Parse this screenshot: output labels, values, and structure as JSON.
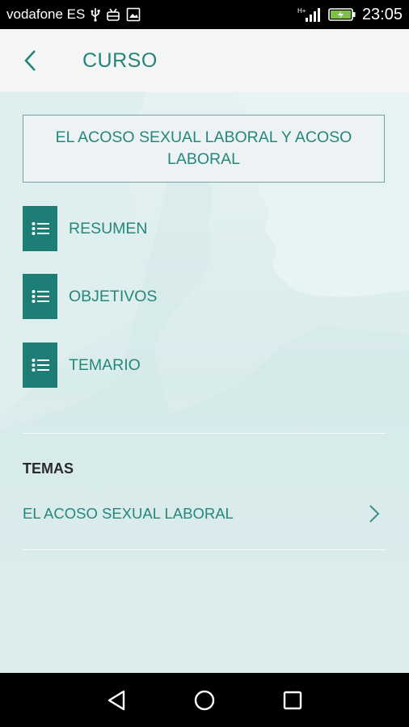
{
  "status_bar": {
    "carrier": "vodafone ES",
    "network": "H+",
    "time": "23:05"
  },
  "header": {
    "title": "CURSO"
  },
  "course": {
    "title": "EL ACOSO SEXUAL LABORAL Y ACOSO LABORAL"
  },
  "menu": [
    {
      "label": "RESUMEN",
      "icon": "list-icon"
    },
    {
      "label": "OBJETIVOS",
      "icon": "list-icon"
    },
    {
      "label": "TEMARIO",
      "icon": "list-icon"
    }
  ],
  "temas": {
    "heading": "TEMAS",
    "items": [
      {
        "label": "EL ACOSO SEXUAL LABORAL"
      }
    ]
  },
  "colors": {
    "accent": "#26877c",
    "icon_bg": "#1e7d74",
    "appbar_bg": "#f4f5f5"
  }
}
